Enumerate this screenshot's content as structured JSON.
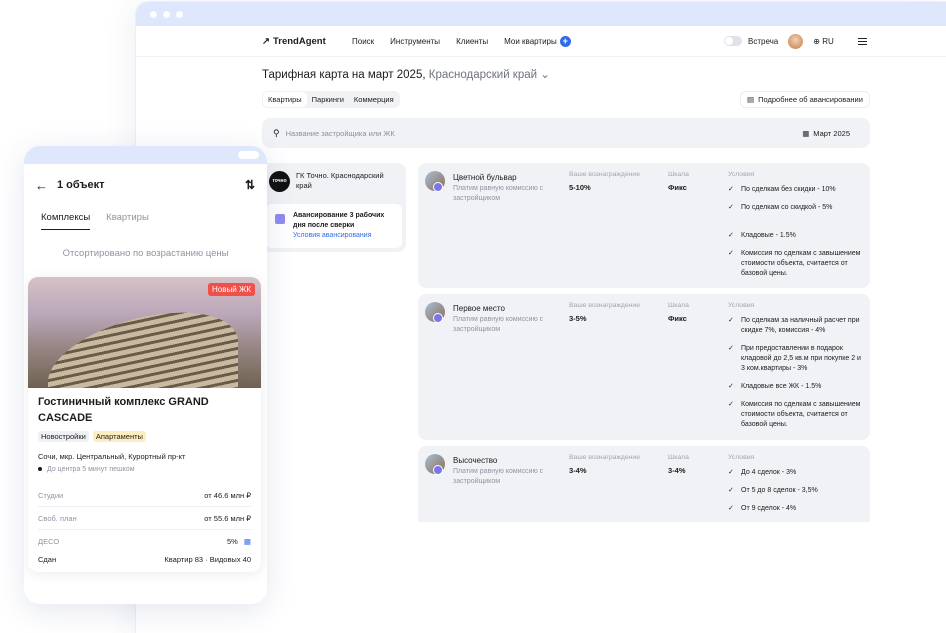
{
  "desktop": {
    "logo": "TrendAgent",
    "nav": [
      "Поиск",
      "Инструменты",
      "Клиенты",
      "Мои квартиры"
    ],
    "meeting_label": "Встреча",
    "lang": "RU",
    "title": "Тарифная карта на март 2025,",
    "region": "Краснодарский край",
    "tabs": [
      "Квартиры",
      "Паркинги",
      "Коммерция"
    ],
    "adv_button": "Подробнее об авансировании",
    "search_placeholder": "Название застройщика или ЖК",
    "date": "Март 2025",
    "developer": {
      "logo_text": "точно",
      "name": "ГК Точно. Краснодарский край",
      "adv_text": "Авансирование 3 рабочих дня после сверки",
      "adv_link": "Условия авансирования"
    },
    "col_labels": {
      "reward": "Ваше вознаграждение",
      "scale": "Шкала",
      "conditions": "Условия"
    },
    "complexes": [
      {
        "name": "Цветной бульвар",
        "sub": "Платим равную комиссию с застройщиком",
        "reward": "5-10%",
        "scale": "Фикс",
        "conditions": [
          "По сделкам без скидки - 10%",
          "По сделкам со скидкой - 5%",
          "Кладовые - 1.5%",
          "Комиссия по сделкам с завышением стоимости объекта, считается от базовой цены."
        ]
      },
      {
        "name": "Первое место",
        "sub": "Платим равную комиссию с застройщиком",
        "reward": "3-5%",
        "scale": "Фикс",
        "conditions": [
          "По сделкам за наличный расчет при скидке 7%, комиссия - 4%",
          "При предоставлении в подарок кладовой до 2,5 кв.м при покупке 2 и 3 ком.квартиры - 3%",
          "Кладовые все ЖК - 1.5%",
          "Комиссия по сделкам с завышением стоимости объекта, считается от базовой цены."
        ]
      },
      {
        "name": "Высочество",
        "sub": "Платим равную комиссию с застройщиком",
        "reward": "3-4%",
        "scale": "3-4%",
        "conditions": [
          "До 4 сделок - 3%",
          "От 5 до 8 сделок - 3,5%",
          "От 9 сделок - 4%"
        ]
      }
    ]
  },
  "mobile": {
    "count": "1 объект",
    "tabs": [
      "Комплексы",
      "Квартиры"
    ],
    "sorted": "Отсортировано по возрастанию цены",
    "card": {
      "badge": "Новый ЖК",
      "title": "Гостиничный комплекс GRAND CASCADE",
      "chips": [
        "Новостройки",
        "Апартаменты"
      ],
      "address": "Сочи, мкр. Центральный, Курортный пр-кт",
      "walk": "До центра 5 минут пешком",
      "prices": [
        {
          "k": "Студии",
          "v": "от 46.6 млн ₽"
        },
        {
          "k": "Своб. план",
          "v": "от 55.6 млн ₽"
        },
        {
          "k": "ДЕСО",
          "v": "5%"
        },
        {
          "k": "Сдан",
          "v": "Квартир 83 · Видовых 40"
        }
      ]
    }
  }
}
